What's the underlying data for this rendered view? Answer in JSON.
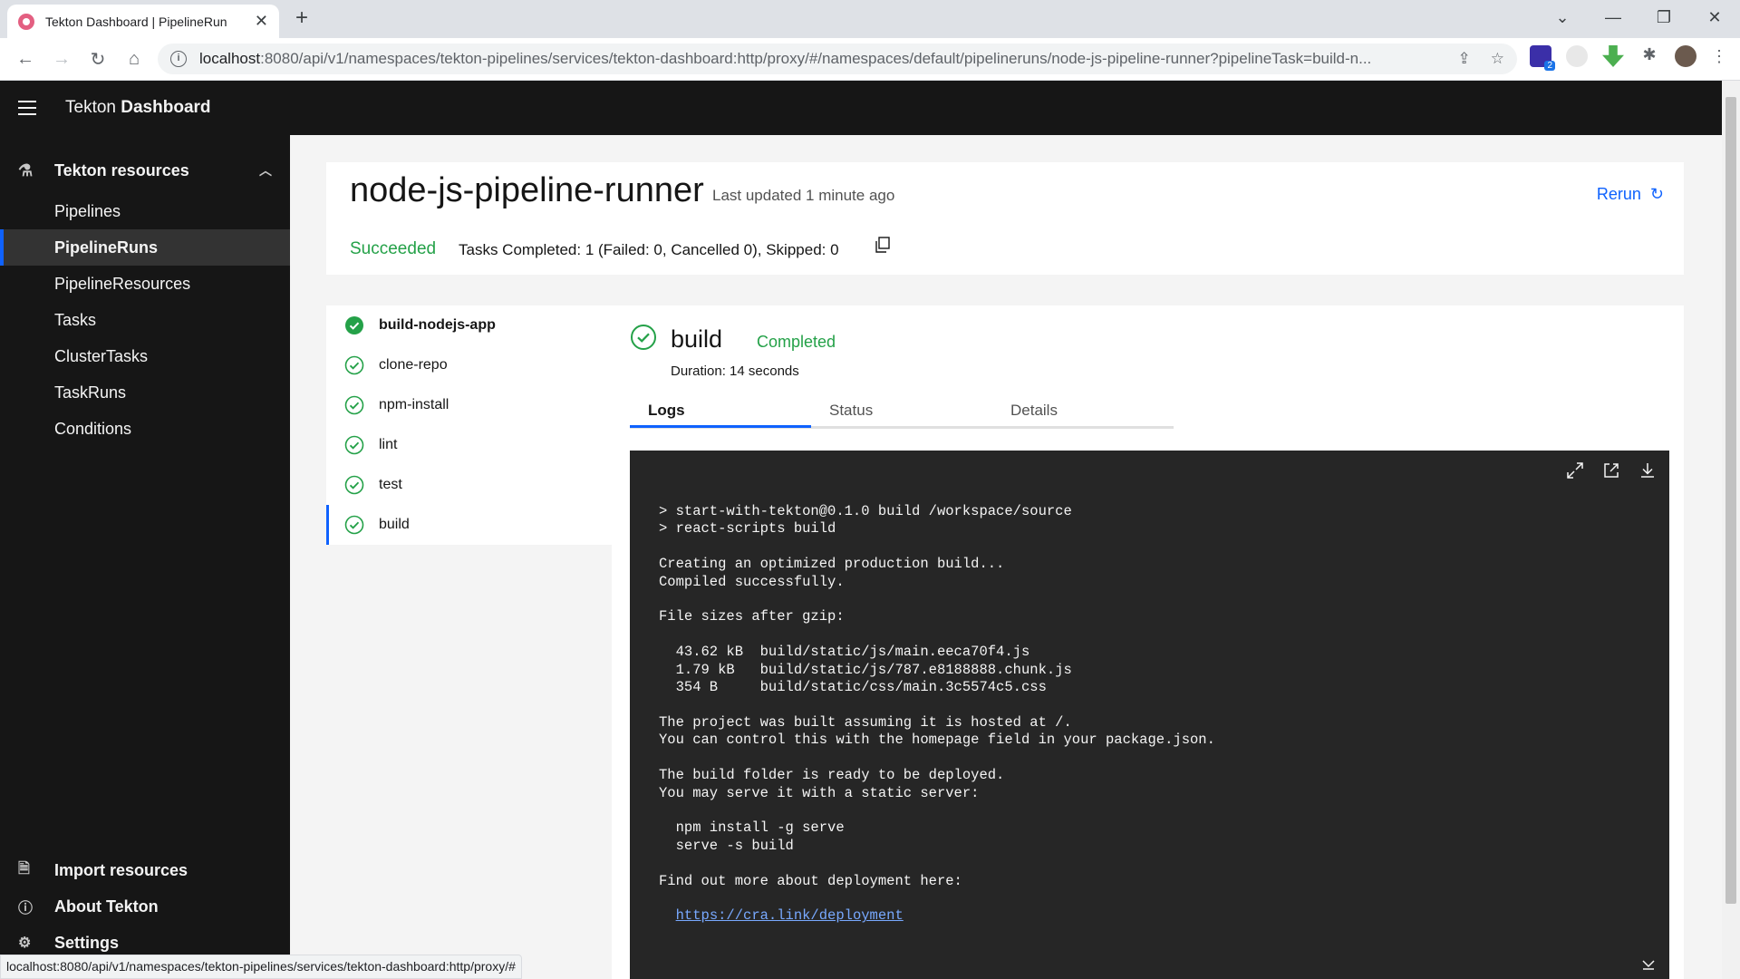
{
  "browser": {
    "tab_title": "Tekton Dashboard | PipelineRun",
    "url_host": "localhost",
    "url_rest": ":8080/api/v1/namespaces/tekton-pipelines/services/tekton-dashboard:http/proxy/#/namespaces/default/pipelineruns/node-js-pipeline-runner?pipelineTask=build-n...",
    "extension_badge": "2",
    "status_url": "localhost:8080/api/v1/namespaces/tekton-pipelines/services/tekton-dashboard:http/proxy/#"
  },
  "app": {
    "title_prefix": "Tekton",
    "title_bold": "Dashboard"
  },
  "sidebar": {
    "section": "Tekton resources",
    "items": [
      {
        "label": "Pipelines"
      },
      {
        "label": "PipelineRuns"
      },
      {
        "label": "PipelineResources"
      },
      {
        "label": "Tasks"
      },
      {
        "label": "ClusterTasks"
      },
      {
        "label": "TaskRuns"
      },
      {
        "label": "Conditions"
      }
    ],
    "bottom": [
      {
        "label": "Import resources"
      },
      {
        "label": "About Tekton"
      },
      {
        "label": "Settings"
      }
    ]
  },
  "run": {
    "name": "node-js-pipeline-runner",
    "last_updated": "Last updated 1 minute ago",
    "rerun_label": "Rerun",
    "status": "Succeeded",
    "summary": "Tasks Completed: 1 (Failed: 0, Cancelled 0), Skipped: 0"
  },
  "tasks": [
    {
      "label": "build-nodejs-app"
    },
    {
      "label": "clone-repo"
    },
    {
      "label": "npm-install"
    },
    {
      "label": "lint"
    },
    {
      "label": "test"
    },
    {
      "label": "build"
    }
  ],
  "step": {
    "name": "build",
    "status": "Completed",
    "duration": "Duration: 14 seconds",
    "tabs": [
      {
        "label": "Logs"
      },
      {
        "label": "Status"
      },
      {
        "label": "Details"
      }
    ]
  },
  "logs": {
    "lines": [
      "> start-with-tekton@0.1.0 build /workspace/source",
      "> react-scripts build",
      "",
      "Creating an optimized production build...",
      "Compiled successfully.",
      "",
      "File sizes after gzip:",
      "",
      "  43.62 kB  build/static/js/main.eeca70f4.js",
      "  1.79 kB   build/static/js/787.e8188888.chunk.js",
      "  354 B     build/static/css/main.3c5574c5.css",
      "",
      "The project was built assuming it is hosted at /.",
      "You can control this with the homepage field in your package.json.",
      "",
      "The build folder is ready to be deployed.",
      "You may serve it with a static server:",
      "",
      "  npm install -g serve",
      "  serve -s build",
      "",
      "Find out more about deployment here:",
      ""
    ],
    "link_indent": "  ",
    "link": "https://cra.link/deployment"
  },
  "colors": {
    "accent": "#0f62fe",
    "success": "#24a148",
    "dark_bg": "#161616",
    "log_bg": "#262626"
  }
}
